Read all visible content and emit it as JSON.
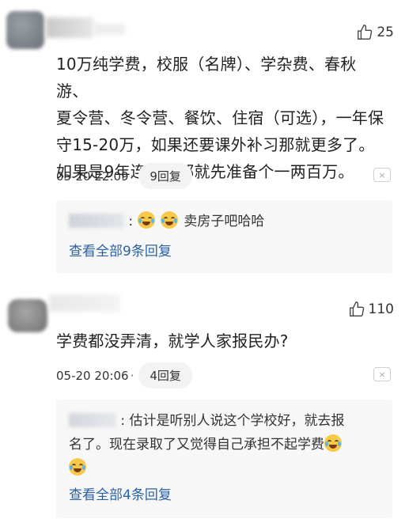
{
  "comments": [
    {
      "likes": "25",
      "content": "10万纯学费，校服（名牌）、学杂费、春秋游、夏令营、冬令营、餐饮、住宿（可选），一年保守15-20万，如果还要课外补习那就更多了。如果是9年连读，那就先准备个一两百万。",
      "content_lines": [
        "10万纯学费，校服（名牌）、学杂费、春秋游、",
        "夏令营、冬令营、餐饮、住宿（可选），一年保",
        "守15-20万，如果还要课外补习那就更多了。",
        "如果是9年连读，那就先准备个一两百万。"
      ],
      "time": "05-20 22:09",
      "reply_count": "9回复",
      "close": "×",
      "reply_preview": {
        "prefix": ":",
        "text": "卖房子吧哈哈"
      },
      "view_all": "查看全部9条回复"
    },
    {
      "likes": "110",
      "content": "学费都没弄清，就学人家报民办?",
      "time": "05-20 20:06",
      "reply_count": "4回复",
      "close": "×",
      "reply_preview": {
        "prefix": ":",
        "line1": "估计是听别人说这个学校好，就去报",
        "line2": "名了。现在录取了又觉得自己承担不起学费"
      },
      "view_all": "查看全部4条回复"
    }
  ],
  "dot": "·",
  "icons": {
    "like": "thumbs-up-icon",
    "emoji": "laugh-cry-emoji-icon",
    "close": "close-icon"
  },
  "colors": {
    "link": "#2a62a4",
    "reply_bg": "#f7f7f7"
  }
}
